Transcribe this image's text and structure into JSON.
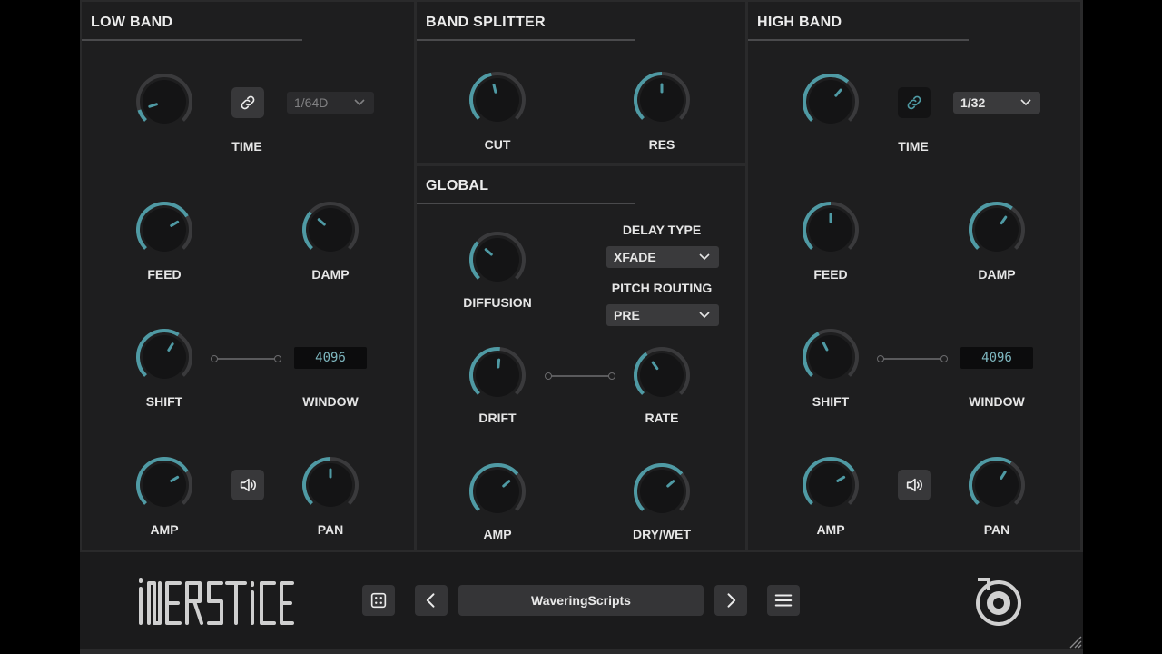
{
  "colors": {
    "accent": "#4f9aa4",
    "track": "#3a3a3c",
    "knob_body": "#141415",
    "panel": "#1e1e1f",
    "frame": "#2a2a2b"
  },
  "low_band": {
    "title": "LOW BAND",
    "time": {
      "label": "TIME",
      "value": 0.1
    },
    "time_link_icon": "link-icon",
    "time_division": "1/64D",
    "feed": {
      "label": "FEED",
      "value": 0.72
    },
    "damp": {
      "label": "DAMP",
      "value": 0.32
    },
    "shift": {
      "label": "SHIFT",
      "value": 0.62
    },
    "window": {
      "label": "WINDOW",
      "value": "4096"
    },
    "amp": {
      "label": "AMP",
      "value": 0.72
    },
    "mute_icon": "speaker-icon",
    "pan": {
      "label": "PAN",
      "value": 0.5
    }
  },
  "band_splitter": {
    "title": "BAND SPLITTER",
    "cut": {
      "label": "CUT",
      "value": 0.45
    },
    "res": {
      "label": "RES",
      "value": 0.5
    }
  },
  "global": {
    "title": "GLOBAL",
    "diffusion": {
      "label": "DIFFUSION",
      "value": 0.32
    },
    "delay_type": {
      "label": "DELAY TYPE",
      "value": "XFADE"
    },
    "pitch_routing": {
      "label": "PITCH ROUTING",
      "value": "PRE"
    },
    "drift": {
      "label": "DRIFT",
      "value": 0.52
    },
    "rate": {
      "label": "RATE",
      "value": 0.37
    },
    "amp": {
      "label": "AMP",
      "value": 0.68
    },
    "dry_wet": {
      "label": "DRY/WET",
      "value": 0.68
    }
  },
  "high_band": {
    "title": "HIGH BAND",
    "time": {
      "label": "TIME",
      "value": 0.65
    },
    "time_link_icon": "link-icon",
    "time_division": "1/32",
    "feed": {
      "label": "FEED",
      "value": 0.5
    },
    "damp": {
      "label": "DAMP",
      "value": 0.63
    },
    "shift": {
      "label": "SHIFT",
      "value": 0.4
    },
    "window": {
      "label": "WINDOW",
      "value": "4096"
    },
    "amp": {
      "label": "AMP",
      "value": 0.72
    },
    "mute_icon": "speaker-icon",
    "pan": {
      "label": "PAN",
      "value": 0.62
    }
  },
  "footer": {
    "logo_text": "INERSTICE",
    "randomize_icon": "dice-icon",
    "prev_icon": "chevron-left-icon",
    "preset_name": "WaveringScripts",
    "next_icon": "chevron-right-icon",
    "menu_icon": "hamburger-menu-icon",
    "brand_icon": "brand-logo-icon"
  }
}
